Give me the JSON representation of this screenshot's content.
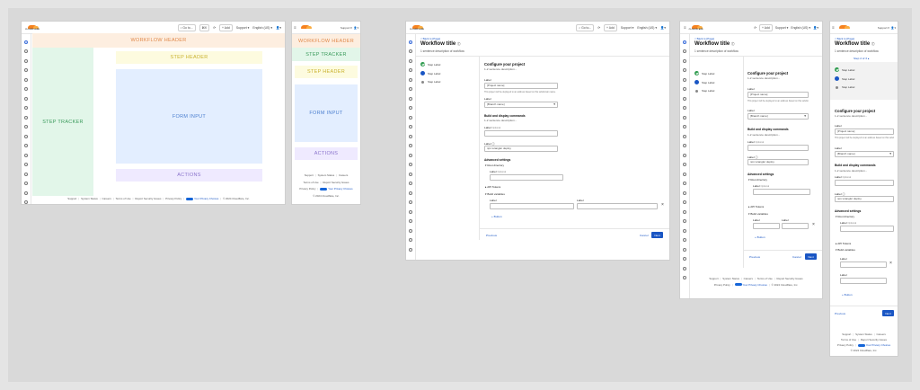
{
  "topbar": {
    "logo_text": "CLOUDFLARE",
    "search": "Go to...",
    "search_kbd": "⌘K",
    "add": "+ Add",
    "support": "Support",
    "language": "English (US)",
    "user_icon": "user-icon",
    "menu_icon": "hamburger-icon"
  },
  "wireframes": {
    "workflow_header": "WORKFLOW HEADER",
    "step_tracker": "STEP TRACKER",
    "step_header": "STEP HEADER",
    "form_input": "FORM INPUT",
    "actions": "ACTIONS"
  },
  "footer": {
    "support": "Support",
    "system_status": "System Status",
    "careers": "Careers",
    "terms": "Terms of Use",
    "report": "Report Security Issues",
    "privacy": "Privacy Policy",
    "choices": "Your Privacy Choices",
    "copyright": "© 2024 Cloudflare, Inc."
  },
  "workflow": {
    "breadcrumb": "< Back to [Page]",
    "title": "Workflow title",
    "description": "1 sentence description of workflow.",
    "steps": [
      {
        "label": "Step Label",
        "state": "done"
      },
      {
        "label": "Step Label",
        "state": "current"
      },
      {
        "label": "Step Label",
        "state": "pending"
      }
    ],
    "step_toggle": "Step 2 of 3"
  },
  "form": {
    "title": "Configure your project",
    "subtitle": "1-2 sentence description...",
    "project_label": "Label",
    "project_value": "[Project name]",
    "project_help": "This project will be deployed to an address based on this subdomain name.",
    "branch_label": "Label",
    "branch_value": "[Branch name]",
    "build_title": "Build and display commands",
    "build_sub": "1-2 sentence description...",
    "optional_label": "Label",
    "optional_tag": "Optional",
    "command_label": "Label",
    "command_value": "npx wrangler deploy",
    "advanced_title": "Advanced settings",
    "root_dir": "Root directory",
    "api_tokens": "API Tokens",
    "build_vars": "Build variables",
    "var_label_1": "Label",
    "var_label_2": "Label",
    "add_button": "+ Button",
    "prev": "Previous",
    "cancel": "Cancel",
    "next": "Next"
  }
}
